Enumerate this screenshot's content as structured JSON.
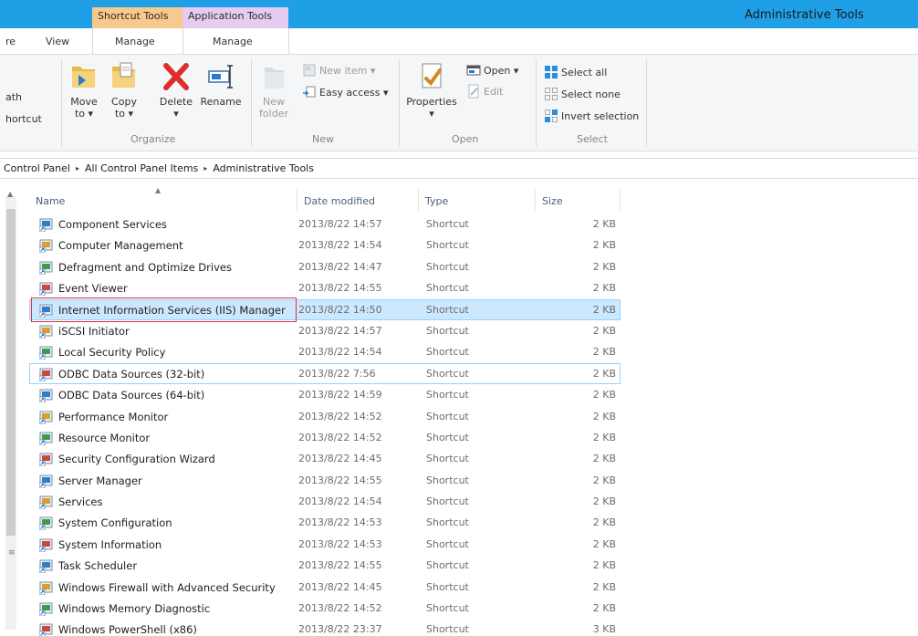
{
  "window": {
    "title": "Administrative Tools",
    "contextual_tabs": [
      "Shortcut Tools",
      "Application Tools"
    ]
  },
  "ribbon_tabs": [
    "re",
    "View",
    "Manage",
    "Manage"
  ],
  "ribbon": {
    "clipboard_partial": [
      "ath",
      "hortcut"
    ],
    "organize": {
      "label": "Organize",
      "move": [
        "Move",
        "to ▾"
      ],
      "copy": [
        "Copy",
        "to ▾"
      ],
      "delete": [
        "Delete",
        "▾"
      ],
      "rename": "Rename"
    },
    "new": {
      "label": "New",
      "new_folder": [
        "New",
        "folder"
      ],
      "new_item": "New item ▾",
      "easy_access": "Easy access ▾"
    },
    "open": {
      "label": "Open",
      "properties": [
        "Properties",
        "▾"
      ],
      "open": "Open ▾",
      "edit": "Edit"
    },
    "select": {
      "label": "Select",
      "select_all": "Select all",
      "select_none": "Select none",
      "invert": "Invert selection"
    }
  },
  "address": {
    "crumbs": [
      "Control Panel",
      "All Control Panel Items",
      "Administrative Tools"
    ],
    "separator": "▸"
  },
  "columns": {
    "name": "Name",
    "date": "Date modified",
    "type": "Type",
    "size": "Size"
  },
  "files": [
    {
      "name": "Component Services",
      "date": "2013/8/22 14:57",
      "type": "Shortcut",
      "size": "2 KB",
      "icon": "component-services-icon"
    },
    {
      "name": "Computer Management",
      "date": "2013/8/22 14:54",
      "type": "Shortcut",
      "size": "2 KB",
      "icon": "computer-management-icon"
    },
    {
      "name": "Defragment and Optimize Drives",
      "date": "2013/8/22 14:47",
      "type": "Shortcut",
      "size": "2 KB",
      "icon": "defrag-icon"
    },
    {
      "name": "Event Viewer",
      "date": "2013/8/22 14:55",
      "type": "Shortcut",
      "size": "2 KB",
      "icon": "event-viewer-icon"
    },
    {
      "name": "Internet Information Services (IIS) Manager",
      "date": "2013/8/22 14:50",
      "type": "Shortcut",
      "size": "2 KB",
      "icon": "iis-manager-icon"
    },
    {
      "name": "iSCSI Initiator",
      "date": "2013/8/22 14:57",
      "type": "Shortcut",
      "size": "2 KB",
      "icon": "iscsi-icon"
    },
    {
      "name": "Local Security Policy",
      "date": "2013/8/22 14:54",
      "type": "Shortcut",
      "size": "2 KB",
      "icon": "security-policy-icon"
    },
    {
      "name": "ODBC Data Sources (32-bit)",
      "date": "2013/8/22 7:56",
      "type": "Shortcut",
      "size": "2 KB",
      "icon": "odbc-icon"
    },
    {
      "name": "ODBC Data Sources (64-bit)",
      "date": "2013/8/22 14:59",
      "type": "Shortcut",
      "size": "2 KB",
      "icon": "odbc-icon"
    },
    {
      "name": "Performance Monitor",
      "date": "2013/8/22 14:52",
      "type": "Shortcut",
      "size": "2 KB",
      "icon": "performance-monitor-icon"
    },
    {
      "name": "Resource Monitor",
      "date": "2013/8/22 14:52",
      "type": "Shortcut",
      "size": "2 KB",
      "icon": "resource-monitor-icon"
    },
    {
      "name": "Security Configuration Wizard",
      "date": "2013/8/22 14:45",
      "type": "Shortcut",
      "size": "2 KB",
      "icon": "security-wizard-icon"
    },
    {
      "name": "Server Manager",
      "date": "2013/8/22 14:55",
      "type": "Shortcut",
      "size": "2 KB",
      "icon": "server-manager-icon"
    },
    {
      "name": "Services",
      "date": "2013/8/22 14:54",
      "type": "Shortcut",
      "size": "2 KB",
      "icon": "services-icon"
    },
    {
      "name": "System Configuration",
      "date": "2013/8/22 14:53",
      "type": "Shortcut",
      "size": "2 KB",
      "icon": "system-configuration-icon"
    },
    {
      "name": "System Information",
      "date": "2013/8/22 14:53",
      "type": "Shortcut",
      "size": "2 KB",
      "icon": "system-information-icon"
    },
    {
      "name": "Task Scheduler",
      "date": "2013/8/22 14:55",
      "type": "Shortcut",
      "size": "2 KB",
      "icon": "task-scheduler-icon"
    },
    {
      "name": "Windows Firewall with Advanced Security",
      "date": "2013/8/22 14:45",
      "type": "Shortcut",
      "size": "2 KB",
      "icon": "firewall-icon"
    },
    {
      "name": "Windows Memory Diagnostic",
      "date": "2013/8/22 14:52",
      "type": "Shortcut",
      "size": "2 KB",
      "icon": "memory-diagnostic-icon"
    },
    {
      "name": "Windows PowerShell (x86)",
      "date": "2013/8/22 23:37",
      "type": "Shortcut",
      "size": "3 KB",
      "icon": "powershell-icon"
    }
  ],
  "selected_index": 4,
  "focused_index": 7,
  "colors": {
    "titlebar": "#1fa0e6",
    "shortcut_tools_tab": "#f8c98c",
    "application_tools_tab": "#e4cdf0",
    "selection": "#cce8ff",
    "highlight_box": "#e0343b"
  }
}
